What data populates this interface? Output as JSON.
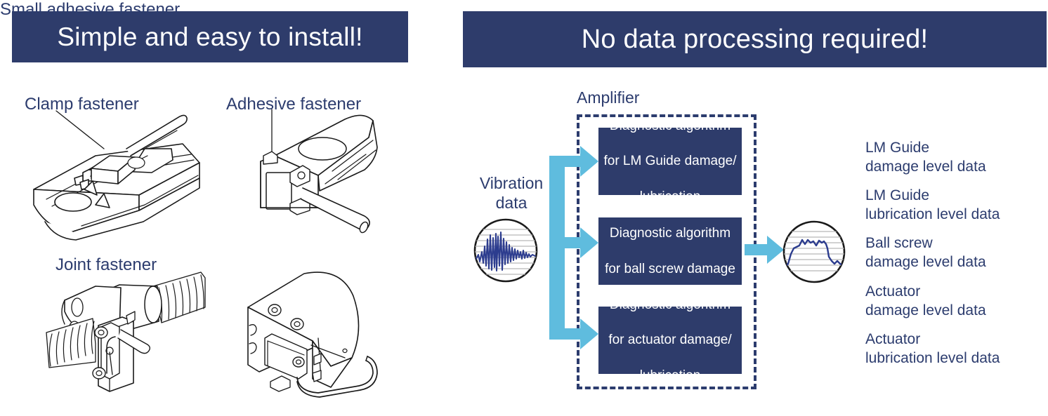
{
  "banners": {
    "left": "Simple and easy to install!",
    "right": "No data processing required!"
  },
  "colors": {
    "navy": "#2E3C6B",
    "text_navy": "#2C3C6E",
    "light_blue": "#5FBCDE",
    "line_art": "#1A1A1A",
    "waveform": "#2C3C8E",
    "white": "#FFFFFF"
  },
  "fasteners": [
    {
      "label": "Clamp fastener",
      "illustration": "lm-guide-block-with-clamp-sensor"
    },
    {
      "label": "Adhesive fastener",
      "illustration": "lm-guide-rail-with-adhesive-sensor"
    },
    {
      "label": "Joint fastener",
      "illustration": "ball-screw-nut-with-joint-bracket-sensor"
    },
    {
      "label": "Small adhesive fastener",
      "illustration": "actuator-body-with-small-adhesive-sensor"
    }
  ],
  "diagram": {
    "amplifier_label": "Amplifier",
    "vibration_label_line1": "Vibration",
    "vibration_label_line2": "data",
    "input_icon": "vibration-waveform-circle-icon",
    "output_icon": "trend-level-curve-circle-icon",
    "algorithms": [
      {
        "line1": "Diagnostic algorithm",
        "line2": "for LM Guide damage/",
        "line3": "lubrication"
      },
      {
        "line1": "Diagnostic algorithm",
        "line2": "for ball screw damage",
        "line3": ""
      },
      {
        "line1": "Diagnostic algorithm",
        "line2": "for actuator damage/",
        "line3": "lubrication"
      }
    ],
    "outputs": [
      {
        "line1": "LM Guide",
        "line2": "damage level data"
      },
      {
        "line1": "LM Guide",
        "line2": "lubrication level data"
      },
      {
        "line1": "Ball screw",
        "line2": "damage level data"
      },
      {
        "line1": "Actuator",
        "line2": "damage level data"
      },
      {
        "line1": "Actuator",
        "line2": "lubrication level data"
      }
    ]
  }
}
